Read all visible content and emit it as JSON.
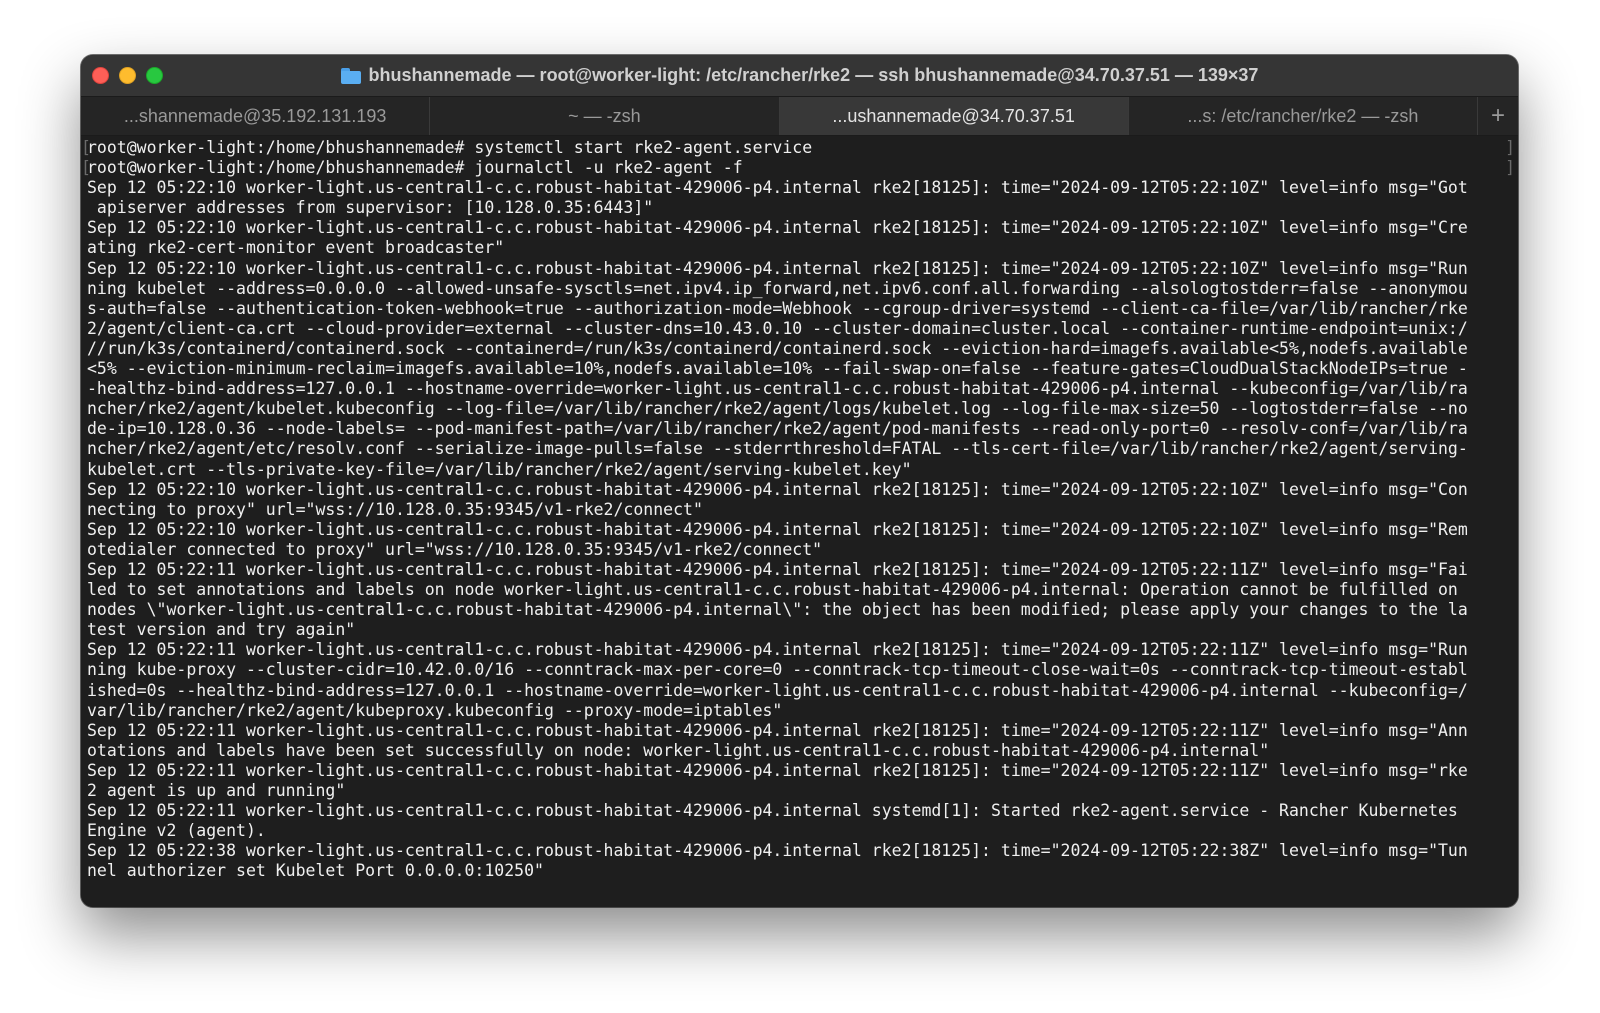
{
  "window": {
    "title": "bhushannemade — root@worker-light: /etc/rancher/rke2 — ssh bhushannemade@34.70.37.51 — 139×37",
    "title_icon": "folder-icon"
  },
  "tabs": [
    {
      "label": "...shannemade@35.192.131.193",
      "active": false
    },
    {
      "label": "~ — -zsh",
      "active": false
    },
    {
      "label": "...ushannemade@34.70.37.51",
      "active": true
    },
    {
      "label": "...s: /etc/rancher/rke2 — -zsh",
      "active": false
    }
  ],
  "new_tab_label": "+",
  "terminal": {
    "prompts": [
      {
        "prompt": "root@worker-light:/home/bhushannemade# ",
        "command": "systemctl start rke2-agent.service"
      },
      {
        "prompt": "root@worker-light:/home/bhushannemade# ",
        "command": "journalctl -u rke2-agent -f"
      }
    ],
    "output_lines": [
      "Sep 12 05:22:10 worker-light.us-central1-c.c.robust-habitat-429006-p4.internal rke2[18125]: time=\"2024-09-12T05:22:10Z\" level=info msg=\"Got",
      " apiserver addresses from supervisor: [10.128.0.35:6443]\"",
      "Sep 12 05:22:10 worker-light.us-central1-c.c.robust-habitat-429006-p4.internal rke2[18125]: time=\"2024-09-12T05:22:10Z\" level=info msg=\"Cre",
      "ating rke2-cert-monitor event broadcaster\"",
      "Sep 12 05:22:10 worker-light.us-central1-c.c.robust-habitat-429006-p4.internal rke2[18125]: time=\"2024-09-12T05:22:10Z\" level=info msg=\"Run",
      "ning kubelet --address=0.0.0.0 --allowed-unsafe-sysctls=net.ipv4.ip_forward,net.ipv6.conf.all.forwarding --alsologtostderr=false --anonymou",
      "s-auth=false --authentication-token-webhook=true --authorization-mode=Webhook --cgroup-driver=systemd --client-ca-file=/var/lib/rancher/rke",
      "2/agent/client-ca.crt --cloud-provider=external --cluster-dns=10.43.0.10 --cluster-domain=cluster.local --container-runtime-endpoint=unix:/",
      "//run/k3s/containerd/containerd.sock --containerd=/run/k3s/containerd/containerd.sock --eviction-hard=imagefs.available<5%,nodefs.available",
      "<5% --eviction-minimum-reclaim=imagefs.available=10%,nodefs.available=10% --fail-swap-on=false --feature-gates=CloudDualStackNodeIPs=true -",
      "-healthz-bind-address=127.0.0.1 --hostname-override=worker-light.us-central1-c.c.robust-habitat-429006-p4.internal --kubeconfig=/var/lib/ra",
      "ncher/rke2/agent/kubelet.kubeconfig --log-file=/var/lib/rancher/rke2/agent/logs/kubelet.log --log-file-max-size=50 --logtostderr=false --no",
      "de-ip=10.128.0.36 --node-labels= --pod-manifest-path=/var/lib/rancher/rke2/agent/pod-manifests --read-only-port=0 --resolv-conf=/var/lib/ra",
      "ncher/rke2/agent/etc/resolv.conf --serialize-image-pulls=false --stderrthreshold=FATAL --tls-cert-file=/var/lib/rancher/rke2/agent/serving-",
      "kubelet.crt --tls-private-key-file=/var/lib/rancher/rke2/agent/serving-kubelet.key\"",
      "Sep 12 05:22:10 worker-light.us-central1-c.c.robust-habitat-429006-p4.internal rke2[18125]: time=\"2024-09-12T05:22:10Z\" level=info msg=\"Con",
      "necting to proxy\" url=\"wss://10.128.0.35:9345/v1-rke2/connect\"",
      "Sep 12 05:22:10 worker-light.us-central1-c.c.robust-habitat-429006-p4.internal rke2[18125]: time=\"2024-09-12T05:22:10Z\" level=info msg=\"Rem",
      "otedialer connected to proxy\" url=\"wss://10.128.0.35:9345/v1-rke2/connect\"",
      "Sep 12 05:22:11 worker-light.us-central1-c.c.robust-habitat-429006-p4.internal rke2[18125]: time=\"2024-09-12T05:22:11Z\" level=info msg=\"Fai",
      "led to set annotations and labels on node worker-light.us-central1-c.c.robust-habitat-429006-p4.internal: Operation cannot be fulfilled on",
      "nodes \\\"worker-light.us-central1-c.c.robust-habitat-429006-p4.internal\\\": the object has been modified; please apply your changes to the la",
      "test version and try again\"",
      "Sep 12 05:22:11 worker-light.us-central1-c.c.robust-habitat-429006-p4.internal rke2[18125]: time=\"2024-09-12T05:22:11Z\" level=info msg=\"Run",
      "ning kube-proxy --cluster-cidr=10.42.0.0/16 --conntrack-max-per-core=0 --conntrack-tcp-timeout-close-wait=0s --conntrack-tcp-timeout-establ",
      "ished=0s --healthz-bind-address=127.0.0.1 --hostname-override=worker-light.us-central1-c.c.robust-habitat-429006-p4.internal --kubeconfig=/",
      "var/lib/rancher/rke2/agent/kubeproxy.kubeconfig --proxy-mode=iptables\"",
      "Sep 12 05:22:11 worker-light.us-central1-c.c.robust-habitat-429006-p4.internal rke2[18125]: time=\"2024-09-12T05:22:11Z\" level=info msg=\"Ann",
      "otations and labels have been set successfully on node: worker-light.us-central1-c.c.robust-habitat-429006-p4.internal\"",
      "Sep 12 05:22:11 worker-light.us-central1-c.c.robust-habitat-429006-p4.internal rke2[18125]: time=\"2024-09-12T05:22:11Z\" level=info msg=\"rke",
      "2 agent is up and running\"",
      "Sep 12 05:22:11 worker-light.us-central1-c.c.robust-habitat-429006-p4.internal systemd[1]: Started rke2-agent.service - Rancher Kubernetes",
      "Engine v2 (agent).",
      "Sep 12 05:22:38 worker-light.us-central1-c.c.robust-habitat-429006-p4.internal rke2[18125]: time=\"2024-09-12T05:22:38Z\" level=info msg=\"Tun",
      "nel authorizer set Kubelet Port 0.0.0.0:10250\""
    ]
  },
  "colors": {
    "background": "#1e1e1e",
    "text": "#f0f0f0",
    "titlebar": "#353535",
    "active_tab": "#383838",
    "close": "#fe5f57",
    "minimize": "#febc2e",
    "zoom": "#28c840"
  }
}
